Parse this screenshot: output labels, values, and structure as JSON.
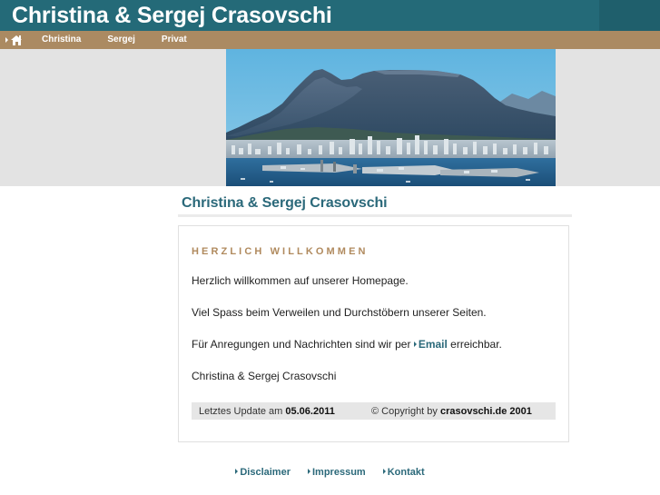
{
  "header": {
    "title": "Christina & Sergej Crasovschi",
    "bg_color": "#246a78",
    "text_color": "#ffffff"
  },
  "nav": {
    "bg_color": "#ab8a62",
    "home_icon": "home-icon",
    "items": [
      {
        "label": "Christina"
      },
      {
        "label": "Sergej"
      },
      {
        "label": "Privat"
      }
    ]
  },
  "banner": {
    "alt": "Table Mountain and Cape Town harbour panorama"
  },
  "main": {
    "heading": "Christina & Sergej Crasovschi",
    "heading_color": "#2b697a",
    "kicker": "HERZLICH WILLKOMMEN",
    "kicker_color": "#b08a5e",
    "paragraphs": [
      "Herzlich willkommen auf unserer Homepage.",
      "Viel Spass beim Verweilen und Durchstöbern unserer Seiten."
    ],
    "contact_line": {
      "before": "Für Anregungen und Nachrichten sind wir per ",
      "link_label": "Email",
      "after": " erreichbar."
    },
    "signature": "Christina & Sergej Crasovschi",
    "meta": {
      "update_prefix": "Letztes Update am ",
      "update_date": "05.06.2011",
      "copyright_prefix": "© Copyright by ",
      "copyright_owner": "crasovschi.de 2001"
    }
  },
  "footer": {
    "links": [
      {
        "label": "Disclaimer"
      },
      {
        "label": "Impressum"
      },
      {
        "label": "Kontakt"
      }
    ]
  }
}
